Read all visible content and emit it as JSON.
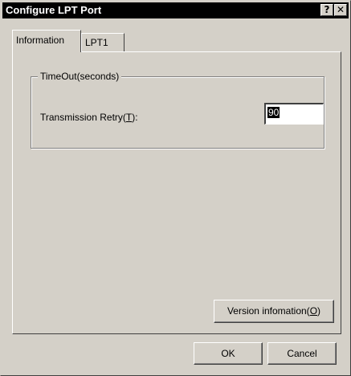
{
  "window": {
    "title": "Configure LPT Port",
    "help_glyph": "?",
    "close_glyph": "✕"
  },
  "tabs": [
    {
      "label": "Information",
      "active": true
    },
    {
      "label": "LPT1",
      "active": false
    }
  ],
  "group": {
    "title": "TimeOut(seconds)",
    "retry_label_prefix": "Transmission Retry(",
    "retry_label_mnemonic": "T",
    "retry_label_suffix": "):",
    "retry_value": "90"
  },
  "buttons": {
    "version_prefix": "Version infomation(",
    "version_mnemonic": "O",
    "version_suffix": ")",
    "ok": "OK",
    "cancel": "Cancel"
  }
}
